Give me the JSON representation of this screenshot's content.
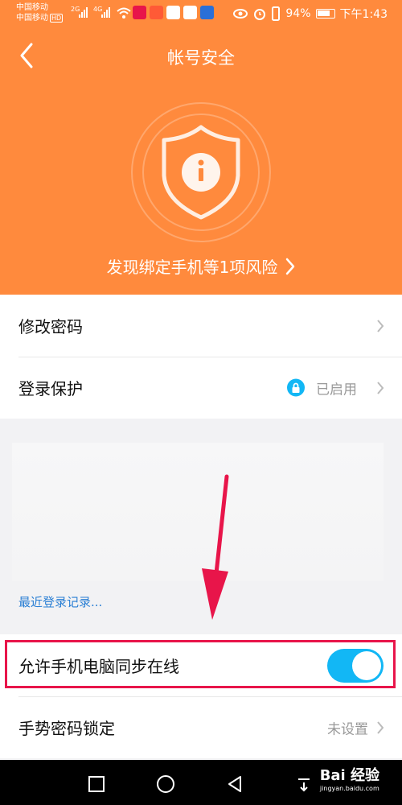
{
  "status_bar": {
    "carrier_1": "中国移动",
    "carrier_2": "中国移动",
    "hd_badge": "HD",
    "net_1": "2G",
    "net_2": "4G",
    "battery": "94%",
    "time": "下午1:43"
  },
  "header": {
    "title": "帐号安全",
    "back_icon": "chevron-left-icon",
    "shield_icon": "shield-info-icon",
    "risk_text": "发现绑定手机等1项风险",
    "bg_color": "#ff8a3d"
  },
  "settings": {
    "change_password": "修改密码",
    "login_protection": "登录保护",
    "login_protection_status": "已启用",
    "recent_login": "最近登录记录...",
    "sync_online": "允许手机电脑同步在线",
    "sync_online_enabled": true,
    "gesture_lock": "手势密码锁定",
    "gesture_lock_status": "未设置"
  },
  "colors": {
    "accent": "#12b7f5",
    "link": "#2a7fd4",
    "annotation": "#e8154a"
  },
  "watermark": {
    "logo": "Bai 经验",
    "url": "jingyan.baidu.com"
  }
}
